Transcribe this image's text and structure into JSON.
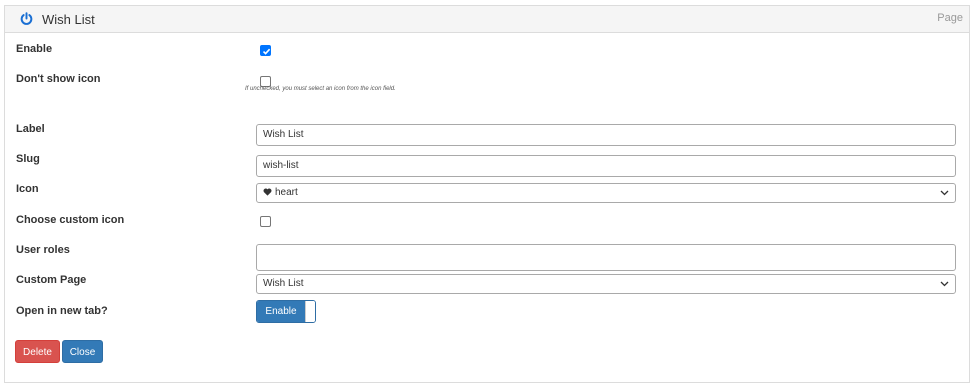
{
  "header": {
    "title": "Wish List",
    "right_label": "Page"
  },
  "form": {
    "enable": {
      "label": "Enable",
      "checked": true
    },
    "dont_show_icon": {
      "label": "Don't show icon",
      "checked": false,
      "help": "If unchecked, you must select an icon from the icon field."
    },
    "label_field": {
      "label": "Label",
      "value": "Wish List"
    },
    "slug_field": {
      "label": "Slug",
      "value": "wish-list"
    },
    "icon_field": {
      "label": "Icon",
      "value": "heart",
      "icon": "heart-icon"
    },
    "custom_icon": {
      "label": "Choose custom icon",
      "checked": false
    },
    "user_roles": {
      "label": "User roles",
      "value": ""
    },
    "custom_page": {
      "label": "Custom Page",
      "value": "Wish List"
    },
    "new_tab": {
      "label": "Open in new tab?",
      "toggle_label": "Enable",
      "on": true
    }
  },
  "buttons": {
    "delete_label": "Delete",
    "close_label": "Close"
  },
  "colors": {
    "primary": "#337ab7",
    "danger": "#d9534f",
    "checkbox_checked": "#0075ff"
  }
}
